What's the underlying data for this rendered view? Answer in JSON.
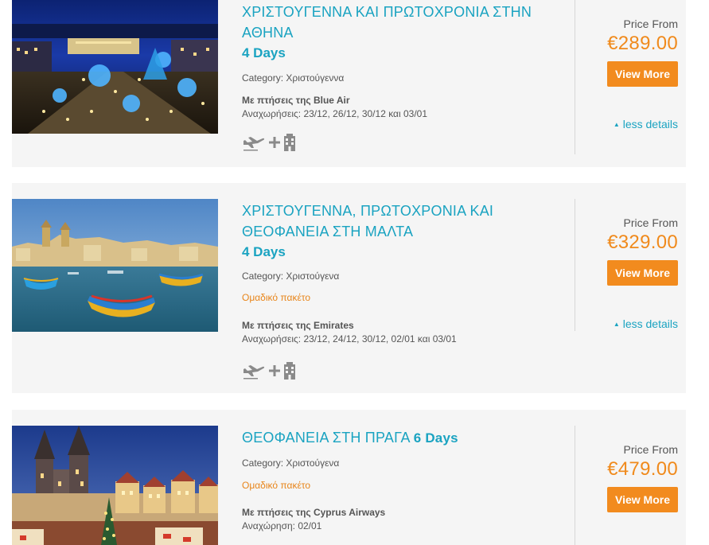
{
  "price_label": "Price From",
  "view_more_label": "View More",
  "less_details_label": "less details",
  "category_prefix": "Category:",
  "listings": [
    {
      "title_line1": "ΧΡΙΣΤΟΥΓΕΝΝΑ ΚΑΙ ΠΡΩΤΟΧΡΟΝΙΑ ΣΤΗΝ",
      "title_line2": "ΑΘΗΝΑ",
      "duration": "4 Days",
      "category": "Category: Χριστούγεννα",
      "flights": "Με πτήσεις της Blue Air",
      "departures": "Αναχωρήσεις: 23/12, 26/12, 30/12 και 03/01",
      "price": "€289.00"
    },
    {
      "title_line1": "ΧΡΙΣΤΟΥΓΕΝΝΑ, ΠΡΩΤΟΧΡΟΝΙΑ ΚΑΙ",
      "title_line2": "ΘΕΟΦΑΝΕΙΑ ΣΤΗ ΜΑΛΤΑ",
      "duration": "4 Days",
      "category": "Category: Χριστούγενα",
      "group_tag": "Ομαδικό πακέτο",
      "flights": "Με πτήσεις της Emirates",
      "departures": "Αναχωρήσεις: 23/12, 24/12, 30/12, 02/01 και 03/01",
      "price": "€329.00"
    },
    {
      "title_line1": "ΘΕΟΦΑΝΕΙΑ ΣΤΗ ΠΡΑΓΑ",
      "duration": "6 Days",
      "category": "Category: Χριστούγενα",
      "group_tag": "Ομαδικό πακέτο",
      "flights": "Με πτήσεις της Cyprus Airways",
      "departures": "Αναχώρηση: 02/01",
      "price": "€479.00"
    }
  ],
  "icons": {
    "flight": "plane-icon",
    "plus": "plus-icon",
    "hotel": "hotel-icon"
  },
  "colors": {
    "accent_teal": "#1aa3c1",
    "accent_orange": "#f28b1e",
    "card_bg": "#f5f5f5"
  }
}
